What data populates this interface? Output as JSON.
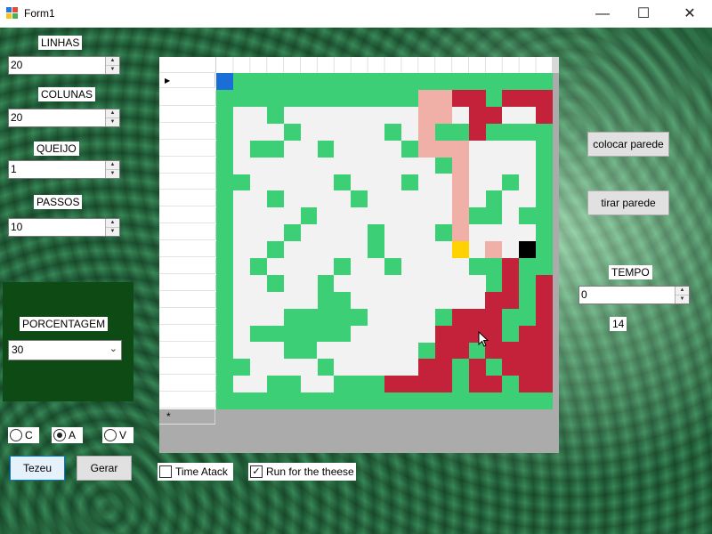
{
  "window": {
    "title": "Form1",
    "minimize_glyph": "—",
    "maximize_glyph": "☐",
    "close_glyph": "✕"
  },
  "left_panel": {
    "linhas": {
      "label": "LINHAS",
      "value": "20"
    },
    "colunas": {
      "label": "COLUNAS",
      "value": "20"
    },
    "queijo": {
      "label": "QUEIJO",
      "value": "1"
    },
    "passos": {
      "label": "PASSOS",
      "value": "10"
    },
    "porcentagem": {
      "label": "PORCENTAGEM",
      "value": "30"
    },
    "radios": [
      {
        "label": "C",
        "checked": false
      },
      {
        "label": "A",
        "checked": true
      },
      {
        "label": "V",
        "checked": false
      }
    ],
    "tezeu_button": "Tezeu",
    "gerar_button": "Gerar"
  },
  "bottom": {
    "time_atack": {
      "label": "Time Atack",
      "checked": false
    },
    "run_cheese": {
      "label": "Run for the theese",
      "checked": true,
      "check_glyph": "✓"
    }
  },
  "grid": {
    "current_row_marker": "▶",
    "new_row_marker": "*",
    "row_count": 20,
    "col_count": 20,
    "colors": {
      "grass": "#3dcf75",
      "wall": "#f2f2f2",
      "trail": "#f0b0a8",
      "path": "#c4213a",
      "start": "#1a6fd6",
      "cheese": "#ffd200",
      "mouse": "#000000"
    },
    "cells": [
      "SGGGGGGGGGGGGGGGGGGG",
      "GGGGGGGGGGGGTTPPGPPP",
      "GWWGWWWWWWWWTTWPPWWP",
      "GWWWGWWWWWGWTGGPGGGG",
      "GWGGWWGWWWWGTTTWWWWG",
      "GWWWWWWWWWWWWGTWWWWG",
      "GGWWWWWGWWWGWWTWWGWG",
      "GWWGWWWWGWWWWWTWGWWG",
      "GWWWWGWWWWWWWWTGGWGG",
      "GWWWGWWWWGWWWGTWWWWG",
      "GWWGWWWWWGWWWWYWTWBG",
      "GWGWWWWGWWGWWWWGGPGG",
      "GWWGWWGWWWWWWWWWGPGP",
      "GWWWWWGGWWWWWWWWPPGP",
      "GWWWGGGGGWWWWGPPPGGP",
      "GWGGGGGGWWWWWPPPPGPP",
      "GWWWGGWWWWWWGPPGPPPP",
      "GGWWWWGWWWWWPPGPGPPP",
      "GWWGGWWGGGPPPPGPPGPP",
      "GGGGGGGGGGGGGGGGGGGG"
    ]
  },
  "right_panel": {
    "colocar_button": "colocar parede",
    "tirar_button": "tirar parede",
    "tempo": {
      "label": "TEMPO",
      "value": "0",
      "counter": "14"
    }
  }
}
